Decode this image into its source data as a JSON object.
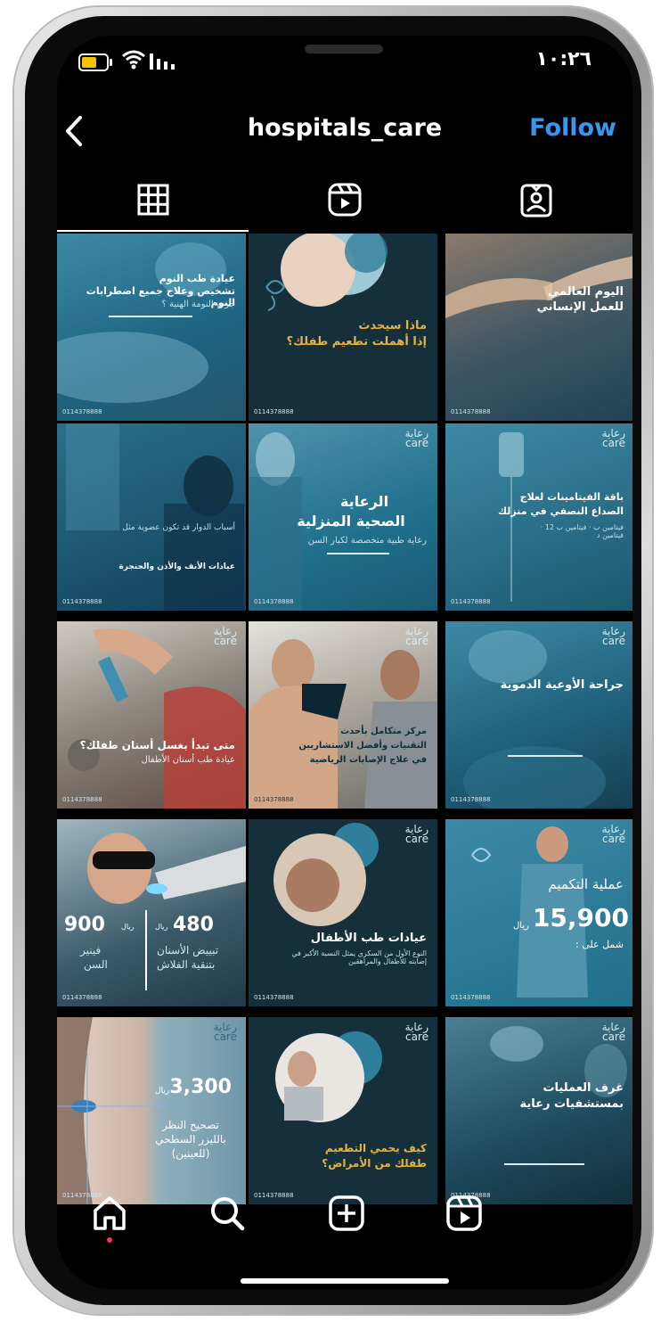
{
  "status": {
    "time": "١٠:٢٦",
    "battery_color": "#f5c400"
  },
  "header": {
    "username": "hospitals_care",
    "follow_label": "Follow",
    "follow_color": "#3897f0"
  },
  "tabs": [
    {
      "icon": "grid-icon",
      "active": true
    },
    {
      "icon": "reels-icon",
      "active": false
    },
    {
      "icon": "tagged-icon",
      "active": false
    }
  ],
  "posts": [
    {
      "title": "عيادة طب النوم",
      "subtitle": "تشخيص وعلاج جميع اضطرابات النوم",
      "note": "جرب النومة الهنية ؟",
      "phone": "0114378888"
    },
    {
      "title": "ماذا سيحدث",
      "subtitle": "إذا أهملت تطعيم طفلك؟",
      "phone": "0114378888"
    },
    {
      "title": "اليوم العالمي",
      "subtitle": "للعمل الإنساني",
      "phone": "0114378888"
    },
    {
      "title": "أسباب الدوار قد تكون عضوية مثل",
      "subtitle": "عيادات الأنف والأذن والحنجرة",
      "phone": "0114378888"
    },
    {
      "title": "الرعاية",
      "subtitle": "الصحية المنزلية",
      "note": "رعاية طبية متخصصة لكبار السن",
      "phone": "0114378888"
    },
    {
      "title": "باقة الفيتامينات لعلاج",
      "subtitle": "الصداع النصفي في منزلك",
      "note": "فيتامين ب · فيتامين ب 12 · فيتامين د",
      "phone": "0114378888"
    },
    {
      "title": "متى تبدأ بغسل أسنان طفلك؟",
      "subtitle": "عيادة طب أسنان الأطفال",
      "phone": "0114378888"
    },
    {
      "title": "مركز متكامل بأحدث",
      "subtitle": "التقنيات وأفضل الاستشاريين",
      "note": "في علاج الإصابات الرياضية",
      "phone": "0114378888"
    },
    {
      "title": "جراحة الأوعية الدموية",
      "phone": "0114378888"
    },
    {
      "price1": "900",
      "label1a": "فينير",
      "label1b": "السن",
      "price2": "480",
      "label2a": "تبييض الأسنان",
      "label2b": "بتنقية الفلاش",
      "currency": "ريال",
      "phone": "0114378888"
    },
    {
      "title": "عيادات طب الأطفال",
      "note": "النوع الأول من السكري يمثل النسبة الأكبر في إصابته للأطفال والمراهقين",
      "phone": "0114378888"
    },
    {
      "title": "عملية التكميم",
      "price": "15,900",
      "currency": "ريال",
      "note": "شمل على :",
      "phone": "0114378888"
    },
    {
      "price": "3,300",
      "currency": "ريال",
      "subtitle": "تصحيح النظر",
      "note": "بالليزر السطحي",
      "note2": "(للعينين)",
      "phone": "0114378888"
    },
    {
      "title": "كيف يحمي التطعيم",
      "subtitle": "طفلك من الأمراض؟",
      "phone": "0114378888"
    },
    {
      "title": "غرف العمليات",
      "subtitle": "بمستشفيات رعاية",
      "phone": "0114378888"
    }
  ],
  "brand": {
    "logo_ar": "رعاية",
    "logo_en": "care",
    "accent": "#1f6f8b",
    "dark": "#15303b",
    "gold": "#e6b43c"
  },
  "bottom_nav": [
    {
      "icon": "home-icon"
    },
    {
      "icon": "search-icon"
    },
    {
      "icon": "add-post-icon"
    },
    {
      "icon": "reels-icon"
    }
  ]
}
